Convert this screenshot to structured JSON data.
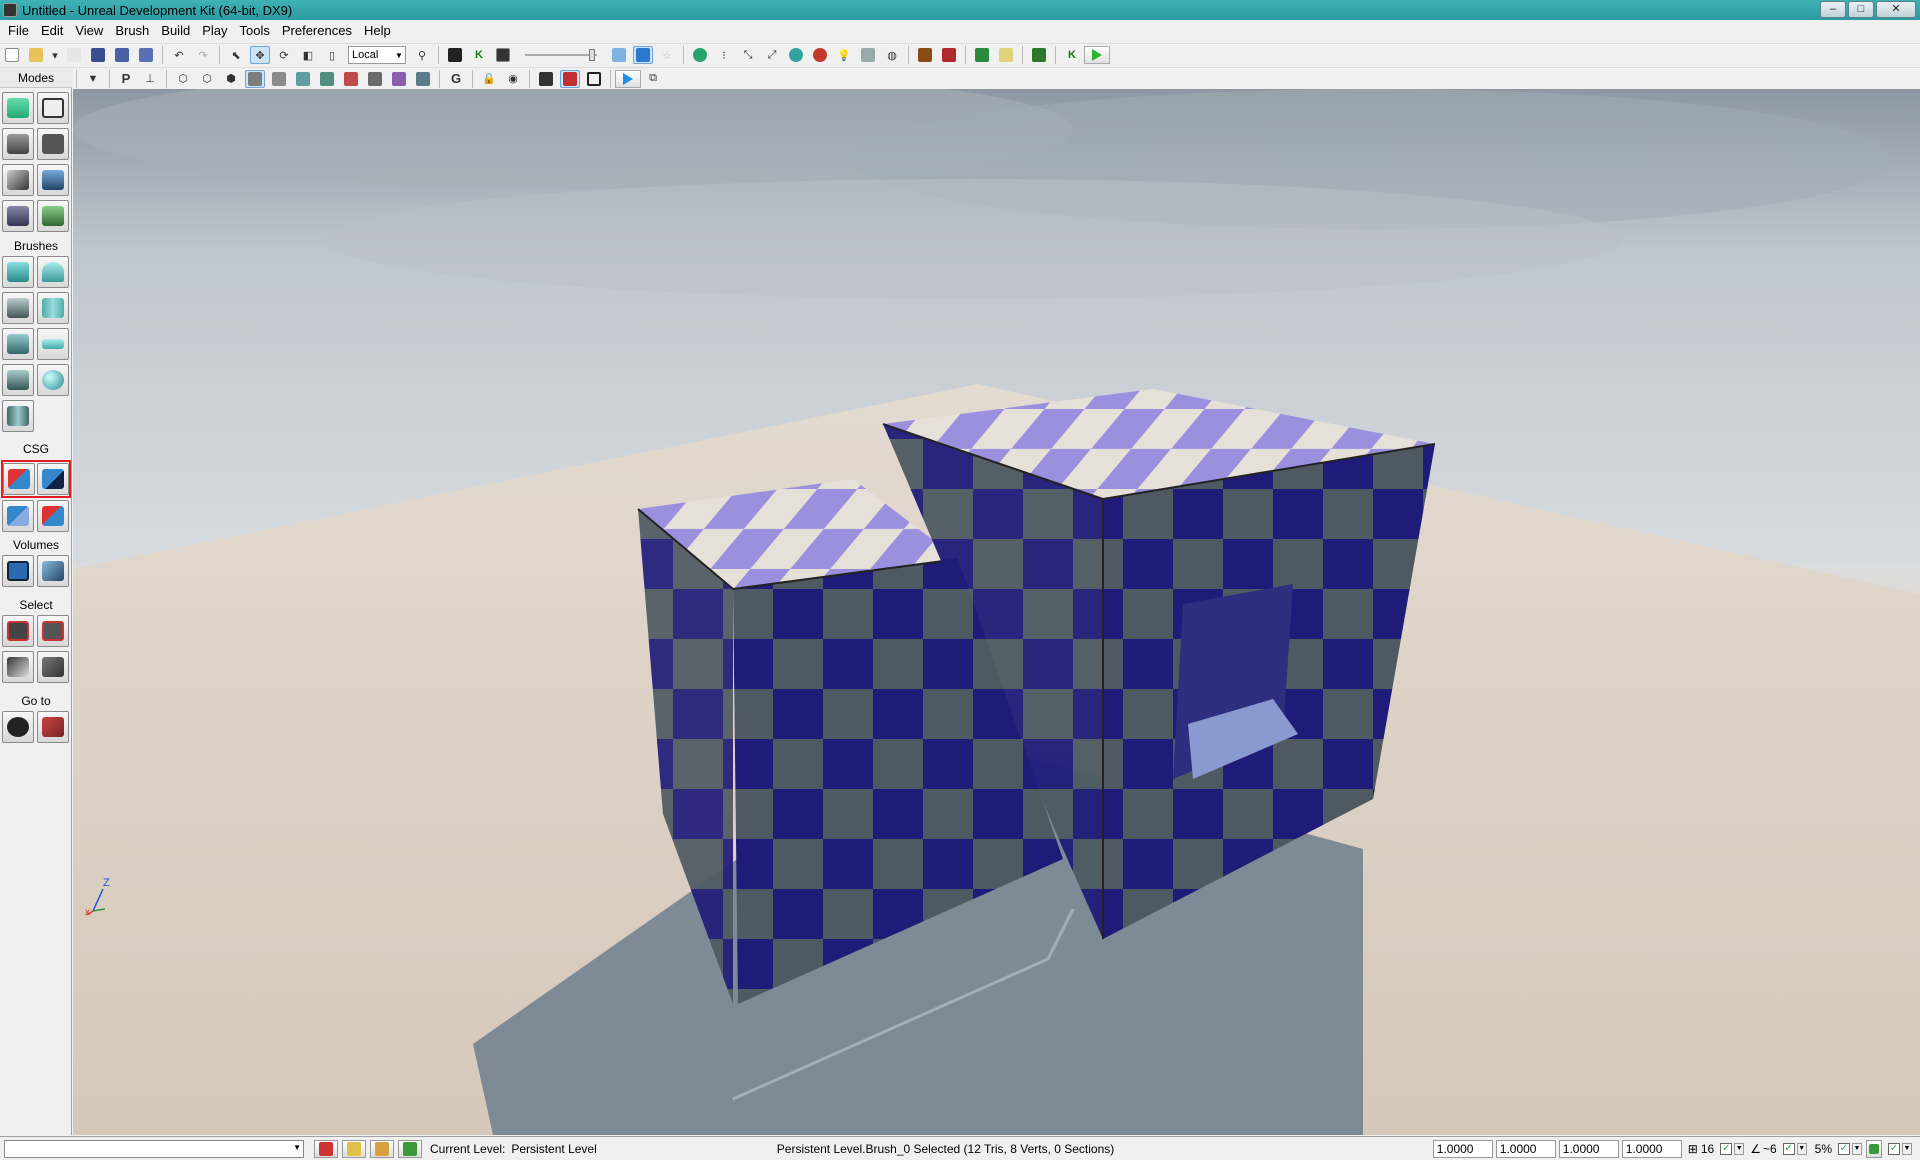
{
  "window": {
    "title": "Untitled - Unreal Development Kit (64-bit, DX9)",
    "minimize": "–",
    "maximize": "□",
    "close": "✕"
  },
  "menu": [
    "File",
    "Edit",
    "View",
    "Brush",
    "Build",
    "Play",
    "Tools",
    "Preferences",
    "Help"
  ],
  "toolbar": {
    "coordinate_system": "Local",
    "builder_brush_label": "P",
    "grid_label": "G"
  },
  "modes_panel": {
    "title": "Modes",
    "sections": {
      "brushes": "Brushes",
      "csg": "CSG",
      "volumes": "Volumes",
      "select": "Select",
      "goto": "Go to"
    }
  },
  "viewport": {
    "axis_z": "Z",
    "axis_x": "x"
  },
  "statusbar": {
    "current_level_label": "Current Level:",
    "current_level_value": "Persistent Level",
    "selection_info": "Persistent Level.Brush_0 Selected (12 Tris, 8 Verts, 0 Sections)",
    "drag_grid": [
      "1.0000",
      "1.0000",
      "1.0000",
      "1.0000"
    ],
    "grid_size": "16",
    "rotation_snap": "~6",
    "scale_snap": "5%"
  },
  "colors": {
    "titlebar": "#2c9aa0",
    "brush_dark_blue": "#1d1a6e",
    "brush_gray": "#4f5a62",
    "checker_light": "#e7e2dc",
    "checker_lavender": "#9c92e0",
    "csg_highlight": "#e02020"
  }
}
